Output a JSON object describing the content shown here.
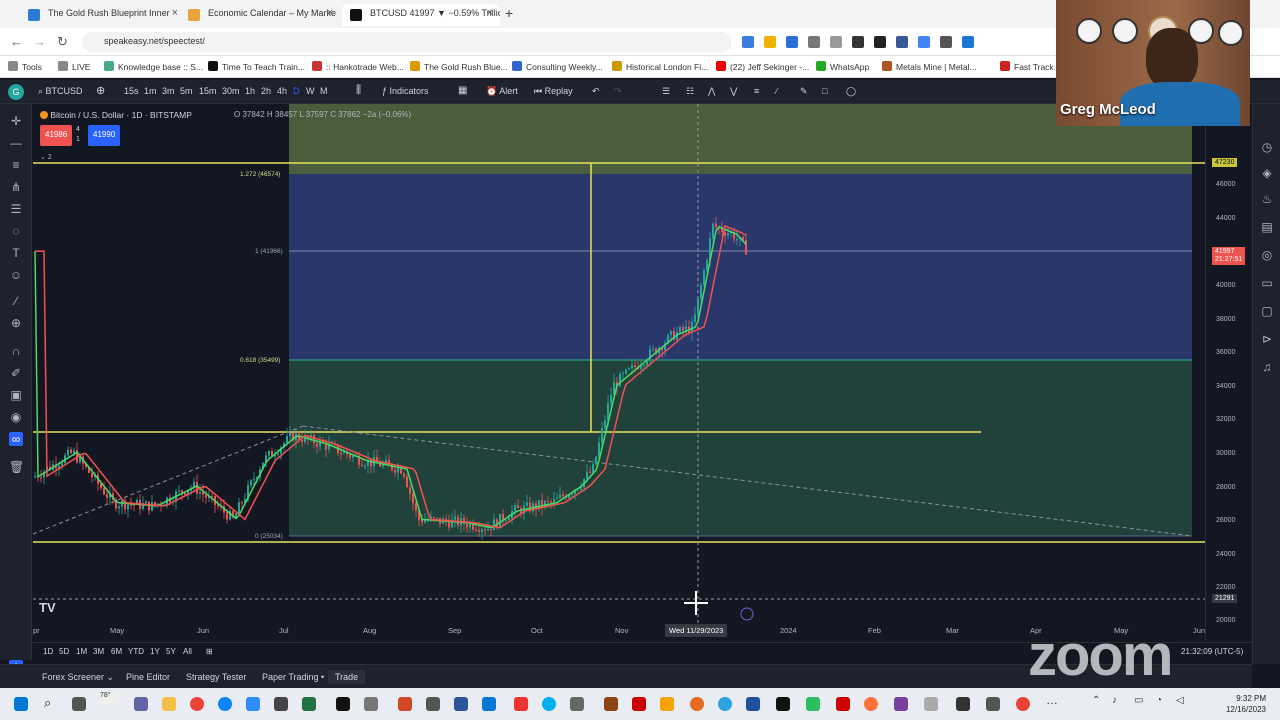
{
  "browser": {
    "tabs": [
      {
        "label": "The Gold Rush Blueprint Inner",
        "icon": "favicon-icon"
      },
      {
        "label": "Economic Calendar – My Marke",
        "icon": "favicon-icon"
      },
      {
        "label": "BTCUSD 41997 ▼ −0.59% Trillio",
        "icon": "tradingview-icon"
      }
    ],
    "url": "speakeasy.net/speectest/",
    "bookmarks": [
      "Tools",
      "LIVE",
      "Knowledge base :: S...",
      "Time To Teach Train...",
      ":: Hankotrade Web...",
      "The Gold Rush Blue...",
      "Consulting Weekly...",
      "Historical London Fi...",
      "(22) Jeff Sekinger -...",
      "WhatsApp",
      "Metals Mine | Metal...",
      "Fast Track Order"
    ]
  },
  "toolbar": {
    "symbol": "BTCUSD",
    "intervals": [
      "15s",
      "1m",
      "3m",
      "5m",
      "15m",
      "30m",
      "1h",
      "2h",
      "4h",
      "D",
      "W",
      "M"
    ],
    "indicators_label": "Indicators",
    "alert_label": "Alert",
    "replay_label": "Replay"
  },
  "chart": {
    "title": "Bitcoin / U.S. Dollar · 1D · BITSTAMP",
    "ohlc": "O 37842  H 38457  L 37597  C 37862  −2a (−0.06%)",
    "bid": "41986",
    "bid_qty": "4",
    "spread": "1",
    "ask": "41990",
    "collapse_count": "2",
    "fib_labels": [
      "1.272 (46574)",
      "1 (41966)",
      "0.618 (35499)",
      "0 (25034)"
    ],
    "price_ticks": [
      "46000",
      "44000",
      "42000",
      "40000",
      "38000",
      "36000",
      "34000",
      "32000",
      "30000",
      "28000",
      "26000",
      "24000",
      "22000",
      "20000"
    ],
    "price_tag_top": "47230",
    "current_price": "41997",
    "current_time": "21:27:51",
    "cursor_price": "21291",
    "time_ticks": [
      "pr",
      "May",
      "Jun",
      "Jul",
      "Aug",
      "Sep",
      "Oct",
      "Nov",
      "2024",
      "Feb",
      "Mar",
      "Apr",
      "May",
      "Jun"
    ],
    "cursor_date": "Wed 11/29/2023",
    "watermark": "TV",
    "chart_clock": "21:32:09 (UTC-5)"
  },
  "ranges": [
    "1D",
    "5D",
    "1M",
    "3M",
    "6M",
    "YTD",
    "1Y",
    "5Y",
    "All"
  ],
  "bottom_tabs": [
    "Forex Screener",
    "Pine Editor",
    "Strategy Tester",
    "Paper Trading",
    "Trade"
  ],
  "zoom": {
    "participant": "Greg McLeod",
    "watermark": "zoom"
  },
  "taskbar": {
    "weather": "78°",
    "time": "9:32 PM",
    "date": "12/16/2023"
  },
  "colors": {
    "bull": "#26a69a",
    "bear": "#ef5350",
    "fib_top": "#3b4d8a",
    "fib_mid": "#2b5f4a",
    "yellow_line": "#e6e35a"
  }
}
